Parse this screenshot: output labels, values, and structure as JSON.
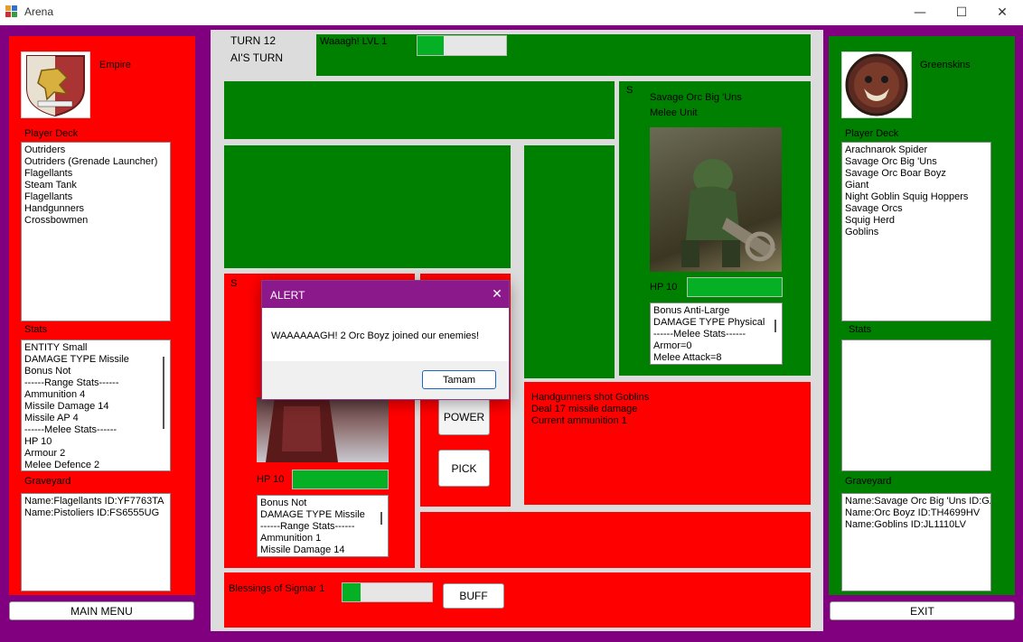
{
  "window": {
    "title": "Arena",
    "minimize": "—",
    "maximize": "☐",
    "close": "✕"
  },
  "left": {
    "faction": "Empire",
    "deck_label": "Player Deck",
    "deck": [
      "Outriders",
      "Outriders (Grenade Launcher)",
      "Flagellants",
      "Steam Tank",
      "Flagellants",
      "Handgunners",
      "Crossbowmen"
    ],
    "stats_label": "Stats",
    "stats": [
      "ENTITY Small",
      "DAMAGE TYPE Missile",
      "Bonus Not",
      "------Range Stats------",
      "Ammunition 4",
      "Missile Damage 14",
      "Missile AP 4",
      "------Melee Stats------",
      "HP 10",
      "Armour 2",
      "Melee Defence 2"
    ],
    "graveyard_label": "Graveyard",
    "graveyard": [
      "Name:Flagellants ID:YF7763TA",
      "Name:Pistoliers ID:FS6555UG"
    ],
    "main_menu": "MAIN MENU"
  },
  "right": {
    "faction": "Greenskins",
    "deck_label": "Player Deck",
    "deck": [
      "Arachnarok Spider",
      "Savage Orc Big 'Uns",
      "Savage Orc Boar Boyz",
      "Giant",
      "Night Goblin Squig Hoppers",
      "Savage Orcs",
      "Squig Herd",
      "Goblins"
    ],
    "stats_label": "Stats",
    "graveyard_label": "Graveyard",
    "graveyard": [
      "Name:Savage Orc Big 'Uns ID:GZ",
      "Name:Orc Boyz ID:TH4699HV",
      "Name:Goblins ID:JL1110LV"
    ],
    "exit": "EXIT"
  },
  "center": {
    "turn": "TURN 12",
    "whose_turn": "AI'S TURN",
    "waaagh_label": "Waaagh! LVL 1",
    "waaagh_progress": 0.3,
    "enemy_card": {
      "slot": "S",
      "name": "Savage Orc Big 'Uns",
      "type": "Melee Unit",
      "hp_label": "HP 10",
      "hp_progress": 1.0,
      "stats": [
        "Bonus Anti-Large",
        "DAMAGE TYPE Physical",
        "------Melee Stats------",
        "Armor=0",
        "Melee Attack=8"
      ]
    },
    "player_card": {
      "slot": "S",
      "hp_label": "HP 10",
      "hp_progress": 1.0,
      "stats": [
        "Bonus Not",
        "DAMAGE TYPE Missile",
        "------Range Stats------",
        "Ammunition 1",
        "Missile Damage 14"
      ]
    },
    "power_button": "POWER",
    "pick_button": "PICK",
    "log": [
      "Handgunners shot Goblins",
      "Deal 17 missile damage",
      "Current ammunition 1"
    ],
    "blessing_label": "Blessings of Sigmar 1",
    "blessing_progress": 0.2,
    "buff_button": "BUFF"
  },
  "alert": {
    "title": "ALERT",
    "message": "WAAAAAAGH! 2 Orc Boyz joined our enemies!",
    "ok": "Tamam"
  },
  "colors": {
    "border": "#800080",
    "player": "#ff0000",
    "enemy": "#008000",
    "progress": "#06b025",
    "dialog_header": "#8b198b"
  }
}
